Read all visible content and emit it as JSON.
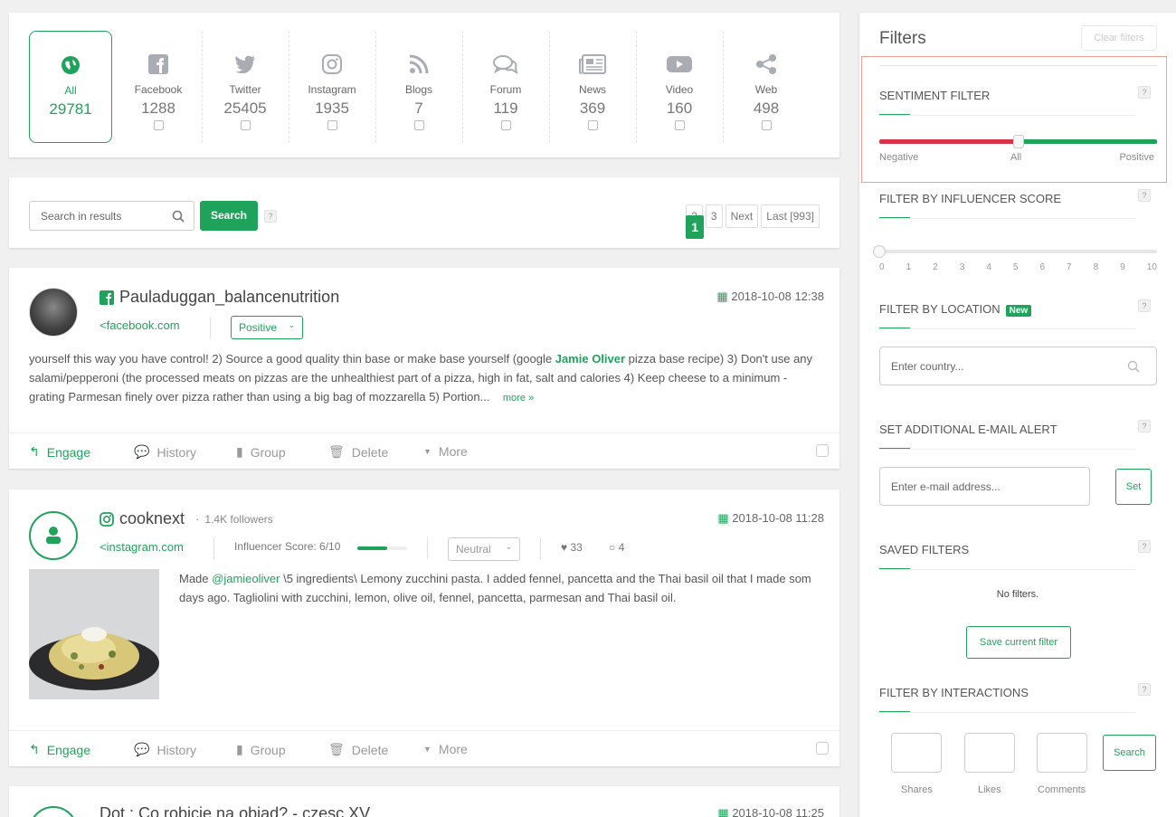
{
  "sources": [
    {
      "name": "All",
      "count": "29781",
      "icon": "globe-icon"
    },
    {
      "name": "Facebook",
      "count": "1288",
      "icon": "facebook-icon"
    },
    {
      "name": "Twitter",
      "count": "25405",
      "icon": "twitter-icon"
    },
    {
      "name": "Instagram",
      "count": "1935",
      "icon": "instagram-icon"
    },
    {
      "name": "Blogs",
      "count": "7",
      "icon": "rss-icon"
    },
    {
      "name": "Forum",
      "count": "119",
      "icon": "forum-icon"
    },
    {
      "name": "News",
      "count": "369",
      "icon": "news-icon"
    },
    {
      "name": "Video",
      "count": "160",
      "icon": "video-icon"
    },
    {
      "name": "Web",
      "count": "498",
      "icon": "share-icon"
    }
  ],
  "search": {
    "placeholder": "Search in results",
    "button": "Search",
    "help": "?"
  },
  "pager": {
    "pages": [
      "1",
      "2",
      "3"
    ],
    "next": "Next",
    "last": "Last [993]"
  },
  "posts": [
    {
      "author": "Pauladuggan_balancenutrition",
      "date": "2018-10-08 12:38",
      "source_link": "facebook.com",
      "sentiment": "Positive",
      "text_a": "yourself this way you have control! 2) Source a good quality thin base or make base yourself (google ",
      "text_highlight": "Jamie Oliver",
      "text_b": " pizza base recipe) 3) Don't use any salami/pepperoni (the processed meats on pizzas are the unhealthiest part of a pizza, high in fat, salt and calories 4) Keep cheese to a minimum - grating Parmesan finely over pizza rather than using a big bag of mozzarella 5) Portion...",
      "more": "more »"
    },
    {
      "author": "cooknext",
      "followers": "1.4K  followers",
      "dot": "·",
      "date": "2018-10-08 11:28",
      "source_link": "instagram.com",
      "influencer_label": "Influencer Score: 6/10",
      "influencer_score": 0.6,
      "sentiment": "Neutral",
      "likes": "33",
      "comments": "4",
      "mention": "@jamieoliver",
      "text_prefix": "Made ",
      "text": " \\5 ingredients\\ Lemony zucchini pasta. I added fennel, pancetta and the Thai basil oil that I made som days ago. Tagliolini with zucchini, lemon, olive oil, fennel, pancetta, parmesan and Thai basil oil."
    },
    {
      "author": "Dot : Co robicie na obiad? - czesc XV",
      "date": "2018-10-08 11:25"
    }
  ],
  "actions": {
    "engage": "Engage",
    "history": "History",
    "group": "Group",
    "delete": "Delete",
    "more": "More"
  },
  "filters": {
    "title": "Filters",
    "clear": "Clear filters",
    "sentiment": {
      "title": "SENTIMENT FILTER",
      "neg": "Negative",
      "all": "All",
      "pos": "Positive",
      "value": 0.5
    },
    "influencer": {
      "title": "FILTER BY INFLUENCER SCORE",
      "ticks": [
        "0",
        "1",
        "2",
        "3",
        "4",
        "5",
        "6",
        "7",
        "8",
        "9",
        "10"
      ],
      "value": 0
    },
    "location": {
      "title": "FILTER BY LOCATION",
      "badge": "New",
      "placeholder": "Enter country..."
    },
    "email": {
      "title": "SET ADDITIONAL E-MAIL ALERT",
      "placeholder": "Enter e-mail address...",
      "button": "Set"
    },
    "saved": {
      "title": "SAVED FILTERS",
      "empty": "No filters.",
      "button": "Save current filter"
    },
    "interactions": {
      "title": "FILTER BY INTERACTIONS",
      "shares": "Shares",
      "likes": "Likes",
      "comments": "Comments",
      "button": "Search"
    },
    "help": "?"
  },
  "colors": {
    "accent": "#1fa35b",
    "negative": "#d9334a",
    "highlight_border": "#f0a090"
  }
}
